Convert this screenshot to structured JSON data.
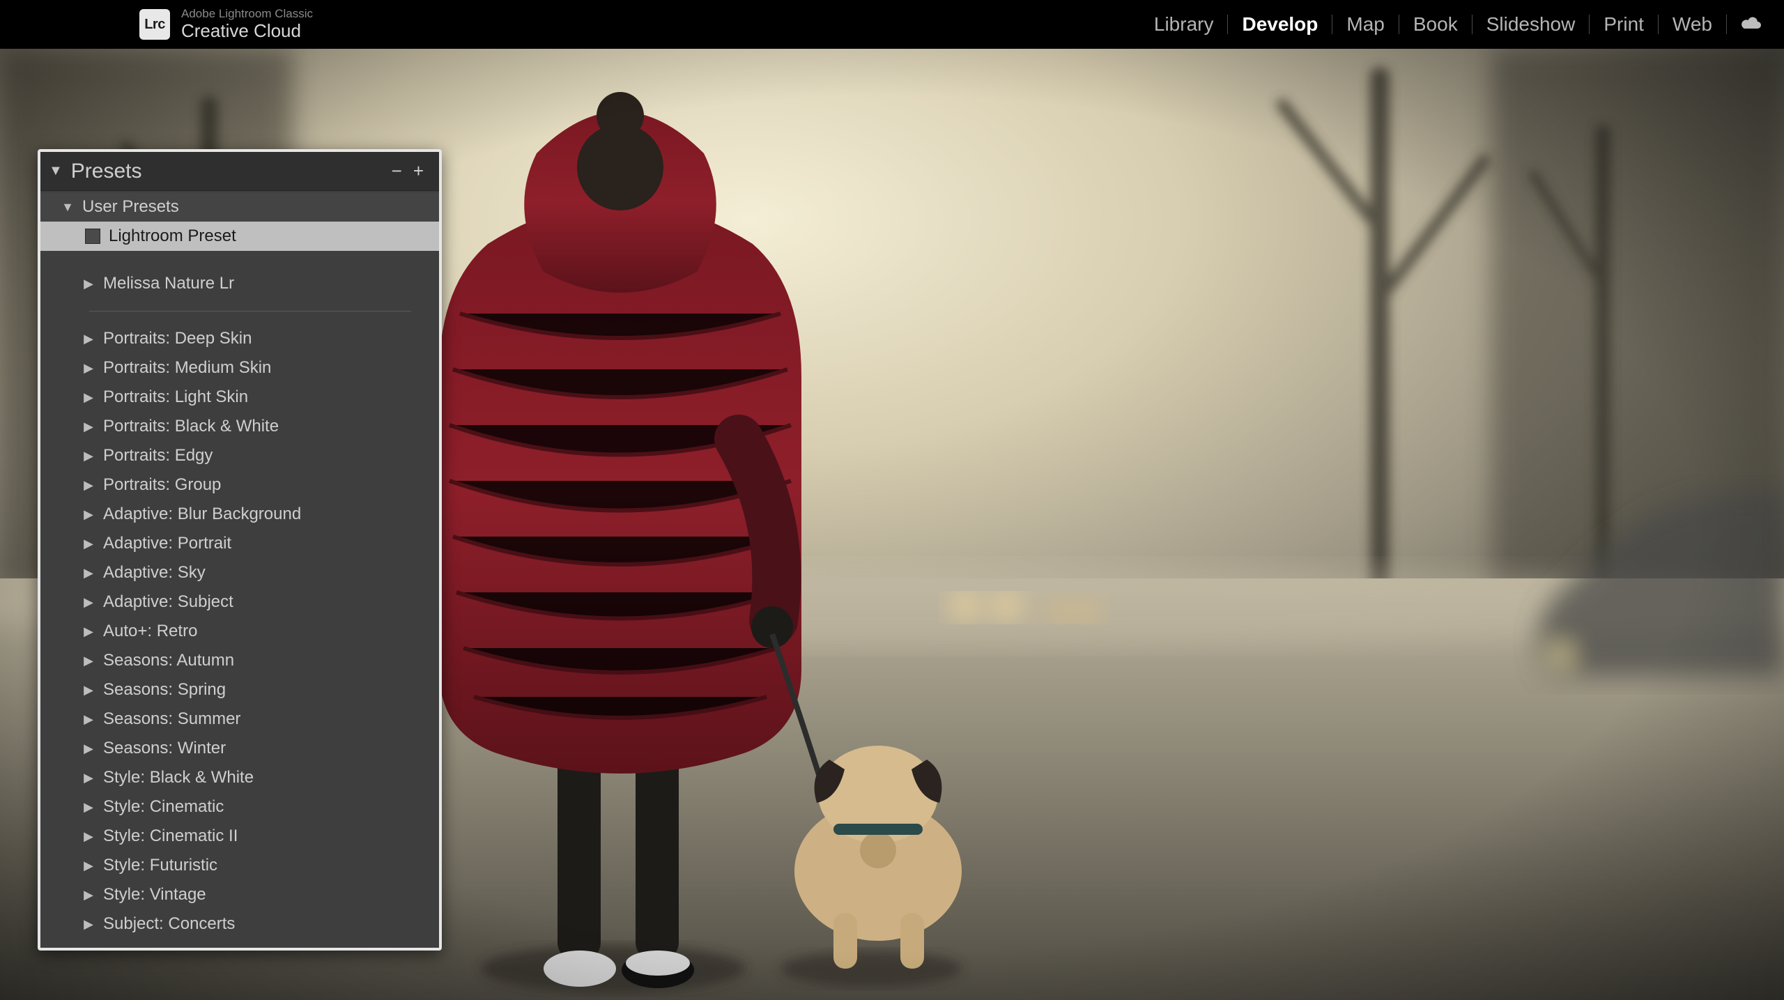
{
  "app": {
    "badge": "Lrc",
    "line1": "Adobe Lightroom Classic",
    "line2": "Creative Cloud"
  },
  "nav": {
    "items": [
      {
        "label": "Library",
        "active": false
      },
      {
        "label": "Develop",
        "active": true
      },
      {
        "label": "Map",
        "active": false
      },
      {
        "label": "Book",
        "active": false
      },
      {
        "label": "Slideshow",
        "active": false
      },
      {
        "label": "Print",
        "active": false
      },
      {
        "label": "Web",
        "active": false
      }
    ]
  },
  "presets": {
    "title": "Presets",
    "minus": "−",
    "plus": "+",
    "user_group": {
      "label": "User Presets",
      "preset": "Lightroom Preset"
    },
    "melissa": {
      "label": "Melissa Nature Lr"
    },
    "groups": [
      "Portraits: Deep Skin",
      "Portraits: Medium Skin",
      "Portraits: Light Skin",
      "Portraits: Black & White",
      "Portraits: Edgy",
      "Portraits: Group",
      "Adaptive: Blur Background",
      "Adaptive: Portrait",
      "Adaptive: Sky",
      "Adaptive: Subject",
      "Auto+: Retro",
      "Seasons: Autumn",
      "Seasons: Spring",
      "Seasons: Summer",
      "Seasons: Winter",
      "Style: Black & White",
      "Style: Cinematic",
      "Style: Cinematic II",
      "Style: Futuristic",
      "Style: Vintage",
      "Subject: Concerts"
    ]
  }
}
